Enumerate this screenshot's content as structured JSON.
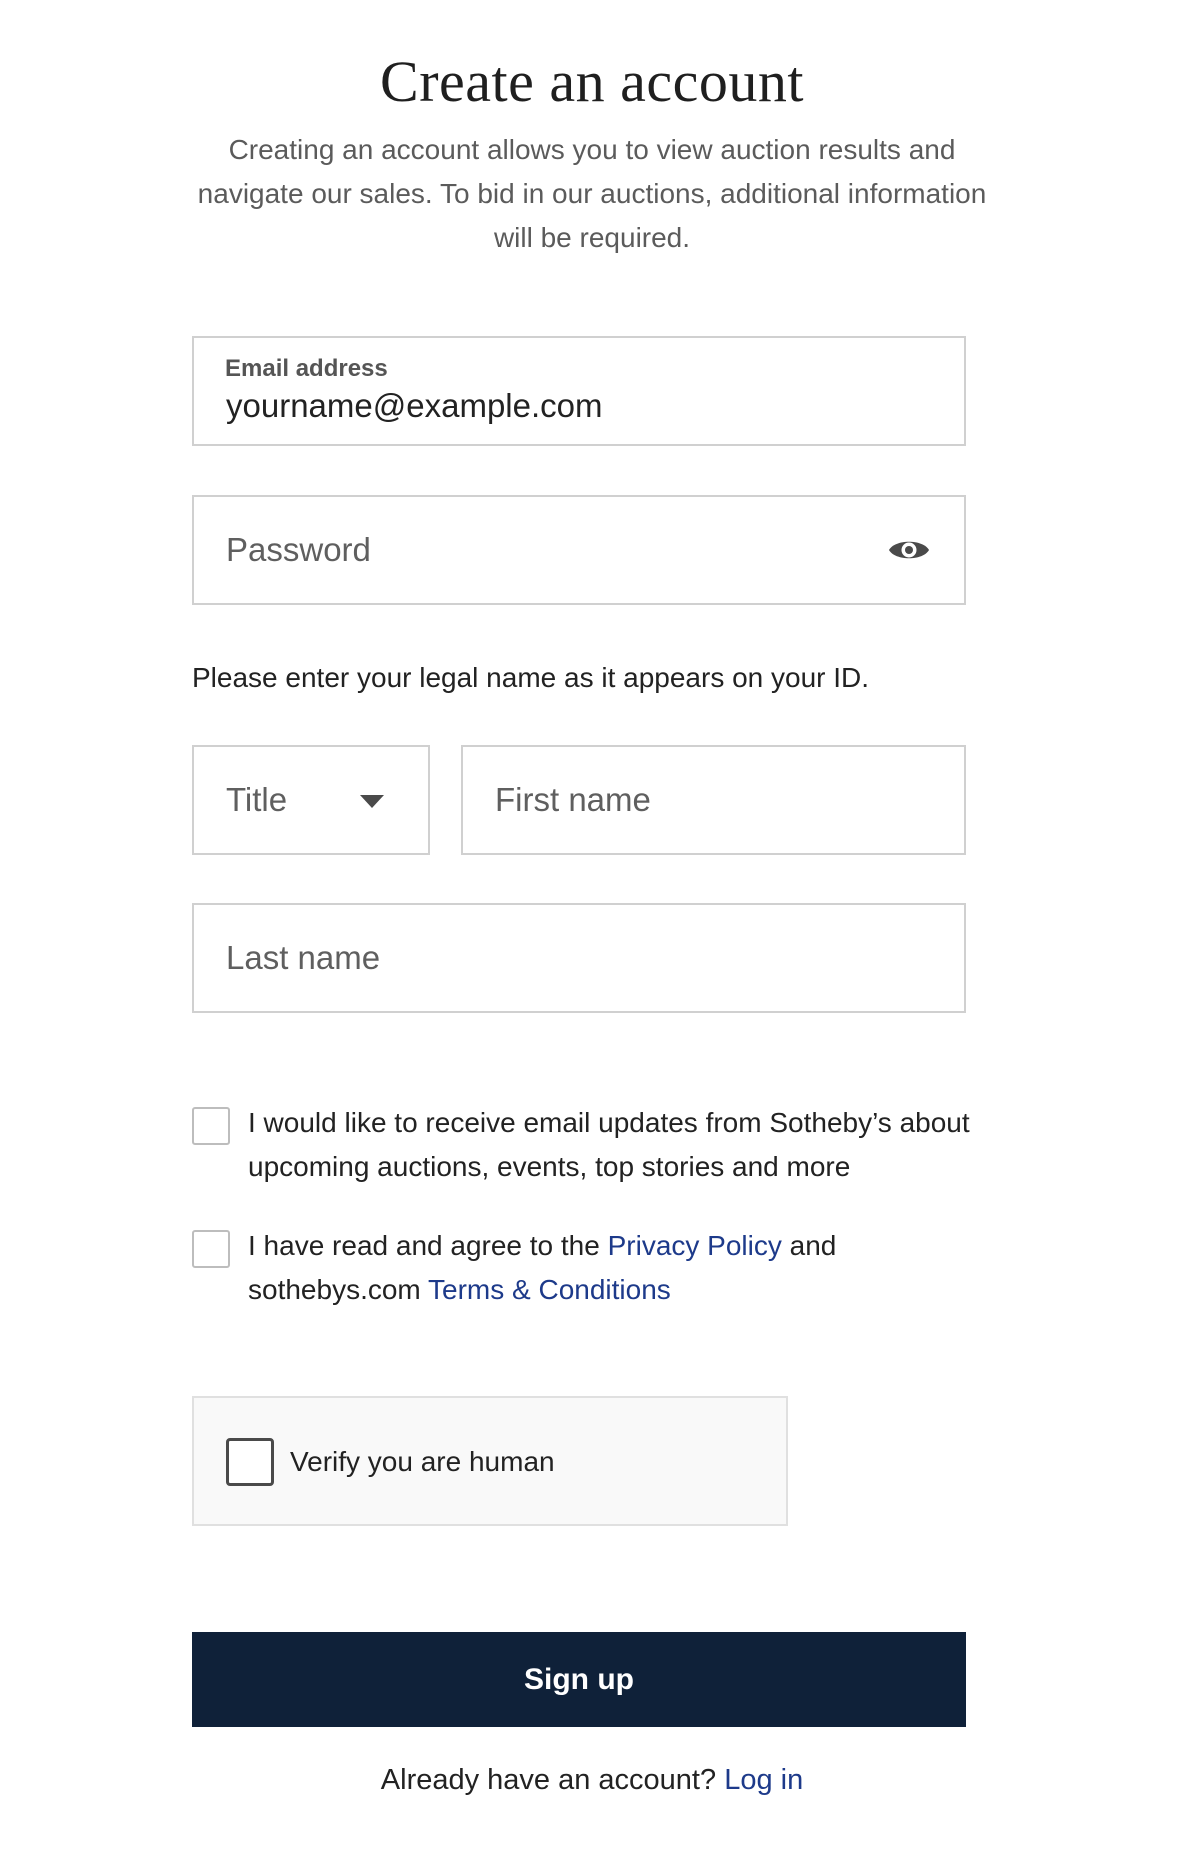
{
  "header": {
    "title": "Create an account",
    "subtitle": "Creating an account allows you to view auction results and navigate our sales. To bid in our auctions, additional information will be required."
  },
  "form": {
    "email": {
      "label": "Email address",
      "value": "yourname@example.com"
    },
    "password": {
      "placeholder": "Password",
      "toggle_icon": "eye-icon"
    },
    "legal_name_hint": "Please enter your legal name as it appears on your ID.",
    "title_select": {
      "selected": "Title",
      "icon": "caret-down-icon"
    },
    "first_name": {
      "placeholder": "First name"
    },
    "last_name": {
      "placeholder": "Last name"
    },
    "marketing_opt_in": {
      "checked": false,
      "text": "I would like to receive email updates from Sotheby’s about upcoming auctions, events, top stories and more"
    },
    "terms": {
      "checked": false,
      "text_before": "I have read and agree to the",
      "privacy_link": "Privacy Policy",
      "text_middle": "and sothebys.com",
      "terms_link": "Terms & Conditions"
    },
    "captcha": {
      "label": "Verify you are human",
      "checked": false
    },
    "submit_label": "Sign up"
  },
  "footer": {
    "prompt": "Already have an account?",
    "login_link": "Log in"
  },
  "colors": {
    "primary_button": "#0f2139",
    "link": "#1d3a8a",
    "border": "#d0d0d0",
    "text": "#222222",
    "muted_text": "#5b5b5b"
  }
}
